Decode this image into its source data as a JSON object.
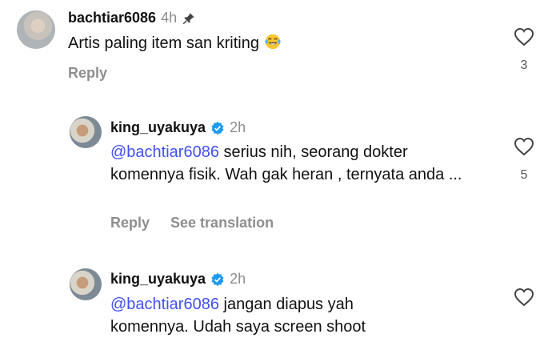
{
  "comments": [
    {
      "username": "bachtiar6086",
      "time": "4h",
      "pinned_icon": "pin-icon",
      "text": "Artis paling item san kriting",
      "emoji": "laughing-tears-emoji",
      "actions": {
        "reply": "Reply"
      },
      "likes": "3"
    },
    {
      "username": "king_uyakuya",
      "verified_icon": "verified-badge-icon",
      "time": "2h",
      "mention": "@bachtiar6086",
      "text": " serius nih, seorang dokter komennya fisik. Wah gak heran , ternyata anda ...",
      "actions": {
        "reply": "Reply",
        "translate": "See translation"
      },
      "likes": "5"
    },
    {
      "username": "king_uyakuya",
      "verified_icon": "verified-badge-icon",
      "time": "2h",
      "mention": "@bachtiar6086",
      "text": " jangan diapus yah",
      "text_cut": "komennya. Udah saya screen shoot"
    }
  ],
  "colors": {
    "mention": "#4150f7",
    "verified": "#1d9bf0",
    "muted": "#8e8e8e"
  }
}
